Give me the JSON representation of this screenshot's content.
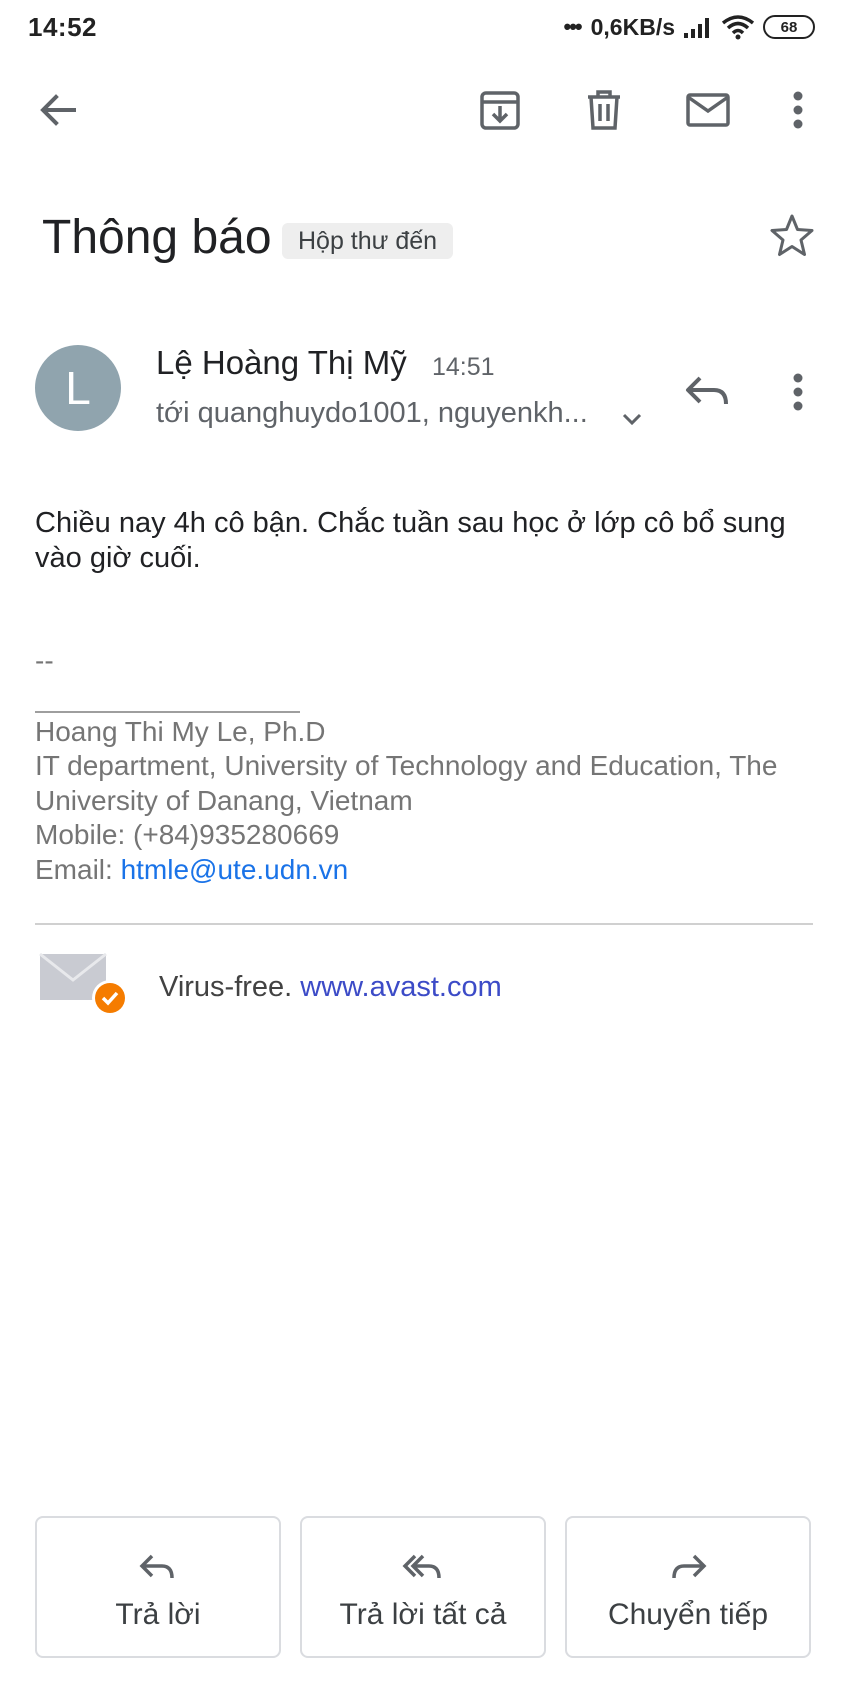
{
  "status_bar": {
    "time": "14:52",
    "dots": "•••",
    "net_speed": "0,6KB/s",
    "battery": "68"
  },
  "toolbar": {
    "icons": [
      "back-arrow-icon",
      "archive-icon",
      "delete-icon",
      "mark-unread-icon",
      "more-vert-icon"
    ]
  },
  "email": {
    "subject": "Thông báo",
    "label": "Hộp thư đến",
    "sender_initial": "L",
    "sender_name": "Lệ Hoàng Thị Mỹ",
    "time": "14:51",
    "recipients": "tới quanghuydo1001, nguyenkh...",
    "body": "Chiều nay 4h cô bận. Chắc tuần sau học ở lớp cô bổ sung vào giờ cuối.",
    "signature": {
      "dash": "--",
      "name": "Hoang Thi My Le, Ph.D",
      "department": "IT department, University of Technology and Education, The University of Danang, Vietnam",
      "mobile": "Mobile: (+84)935280669",
      "email_prefix": "Email: ",
      "email": "htmle@ute.udn.vn"
    },
    "avast": {
      "text": "Virus-free. ",
      "link": "www.avast.com"
    }
  },
  "actions": {
    "reply": "Trả lời",
    "reply_all": "Trả lời tất cả",
    "forward": "Chuyển tiếp"
  },
  "colors": {
    "avatar": "#90a4ae",
    "link": "#1a73e8",
    "avast_badge": "#f57c00"
  }
}
